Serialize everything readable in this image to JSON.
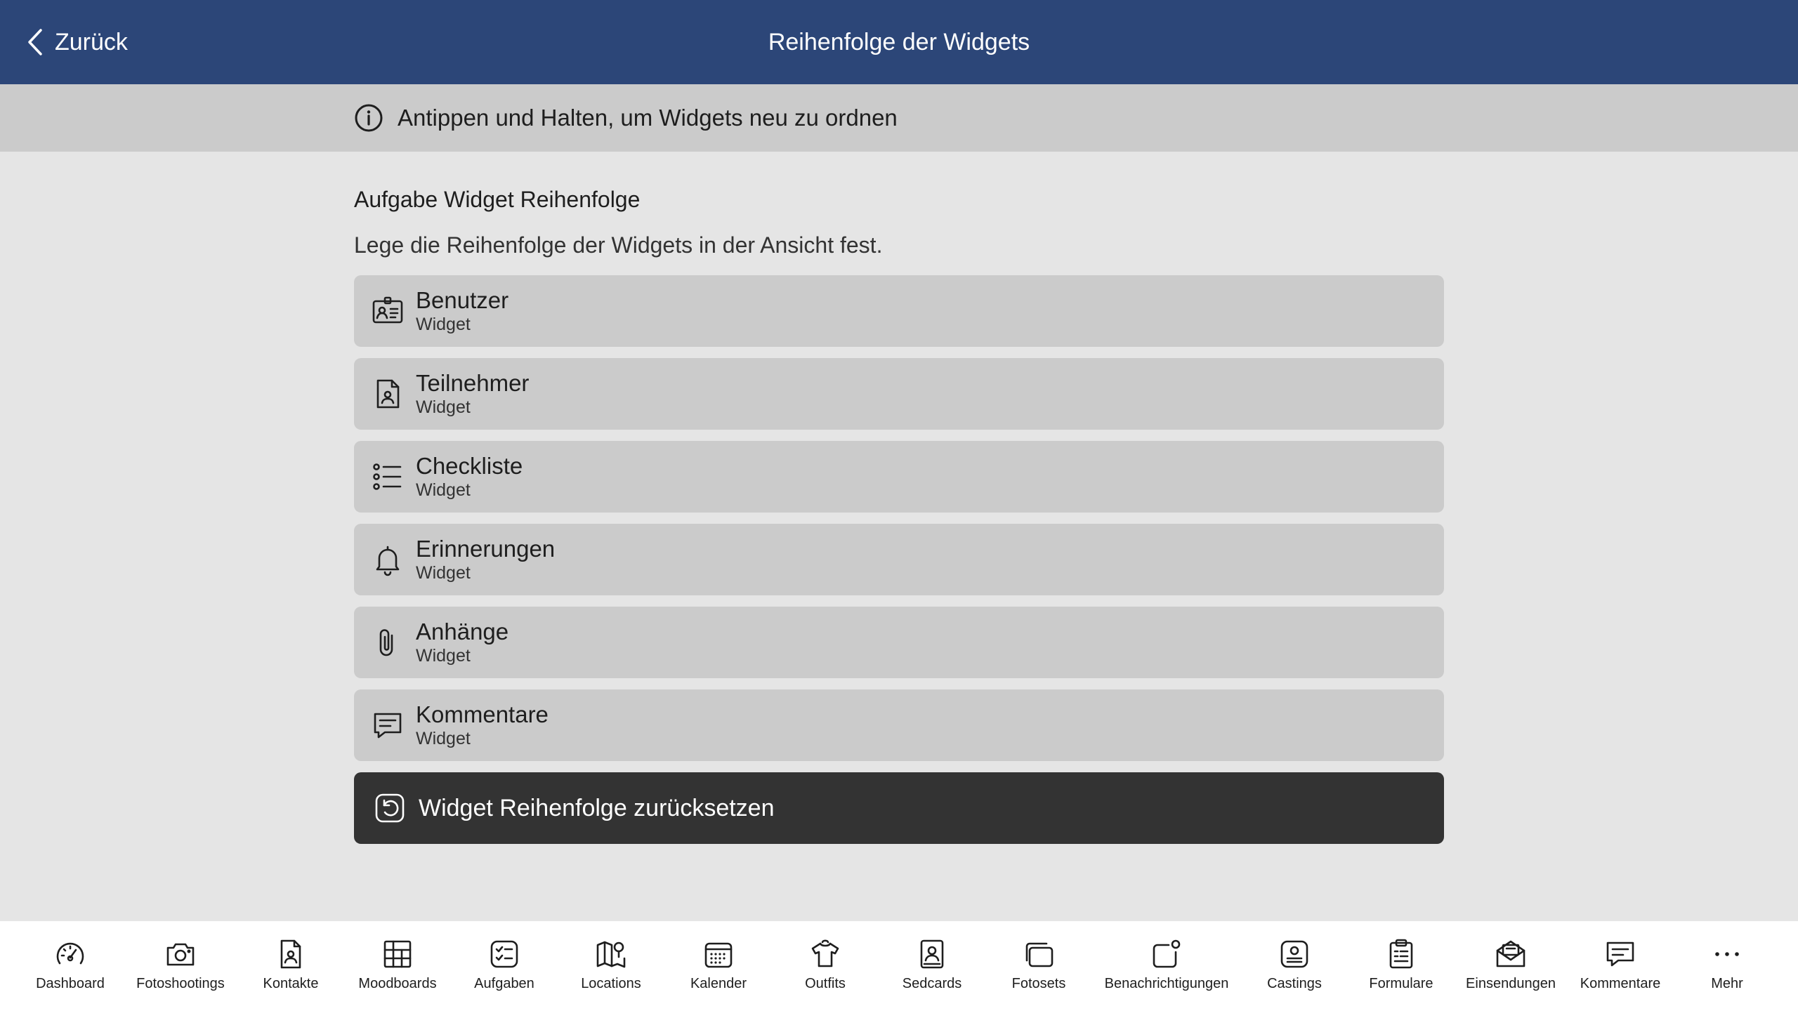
{
  "header": {
    "back_label": "Zurück",
    "title": "Reihenfolge der Widgets",
    "background": "#2c4678"
  },
  "info": {
    "text": "Antippen und Halten, um Widgets neu zu ordnen"
  },
  "section": {
    "title": "Aufgabe Widget Reihenfolge",
    "description": "Lege die Reihenfolge der Widgets in der Ansicht fest."
  },
  "widgets": [
    {
      "name": "Benutzer",
      "sub": "Widget",
      "icon": "user-card-icon"
    },
    {
      "name": "Teilnehmer",
      "sub": "Widget",
      "icon": "contact-file-icon"
    },
    {
      "name": "Checkliste",
      "sub": "Widget",
      "icon": "checklist-icon"
    },
    {
      "name": "Erinnerungen",
      "sub": "Widget",
      "icon": "bell-icon"
    },
    {
      "name": "Anhänge",
      "sub": "Widget",
      "icon": "paperclip-icon"
    },
    {
      "name": "Kommentare",
      "sub": "Widget",
      "icon": "comment-icon"
    }
  ],
  "reset_button": {
    "label": "Widget Reihenfolge zurücksetzen",
    "icon": "reset-icon"
  },
  "tabbar": {
    "items": [
      {
        "label": "Dashboard",
        "icon": "speedometer-icon"
      },
      {
        "label": "Fotoshootings",
        "icon": "camera-icon"
      },
      {
        "label": "Kontakte",
        "icon": "contact-file-icon"
      },
      {
        "label": "Moodboards",
        "icon": "moodboard-icon"
      },
      {
        "label": "Aufgaben",
        "icon": "tasks-icon"
      },
      {
        "label": "Locations",
        "icon": "map-pin-icon"
      },
      {
        "label": "Kalender",
        "icon": "calendar-icon"
      },
      {
        "label": "Outfits",
        "icon": "shirt-icon"
      },
      {
        "label": "Sedcards",
        "icon": "sedcard-icon"
      },
      {
        "label": "Fotosets",
        "icon": "photo-stack-icon"
      },
      {
        "label": "Benachrichtigungen",
        "icon": "notification-icon"
      },
      {
        "label": "Castings",
        "icon": "casting-icon"
      },
      {
        "label": "Formulare",
        "icon": "clipboard-icon"
      },
      {
        "label": "Einsendungen",
        "icon": "mail-open-icon"
      },
      {
        "label": "Kommentare",
        "icon": "comment-icon"
      },
      {
        "label": "Mehr",
        "icon": "more-icon"
      }
    ]
  }
}
